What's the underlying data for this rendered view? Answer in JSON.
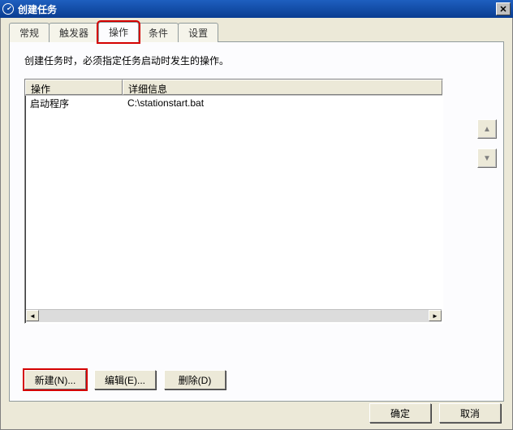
{
  "window": {
    "title": "创建任务",
    "close_glyph": "✕"
  },
  "tabs": {
    "general": "常规",
    "triggers": "触发器",
    "actions": "操作",
    "conditions": "条件",
    "settings": "设置"
  },
  "description": "创建任务时，必须指定任务启动时发生的操作。",
  "columns": {
    "action": "操作",
    "detail": "详细信息"
  },
  "rows": [
    {
      "action": "启动程序",
      "detail": "C:\\stationstart.bat"
    }
  ],
  "side": {
    "up": "▲",
    "down": "▼"
  },
  "hscroll": {
    "left": "◄",
    "right": "►"
  },
  "buttons": {
    "new": "新建(N)...",
    "edit": "编辑(E)...",
    "delete": "删除(D)"
  },
  "footer": {
    "ok": "确定",
    "cancel": "取消"
  }
}
